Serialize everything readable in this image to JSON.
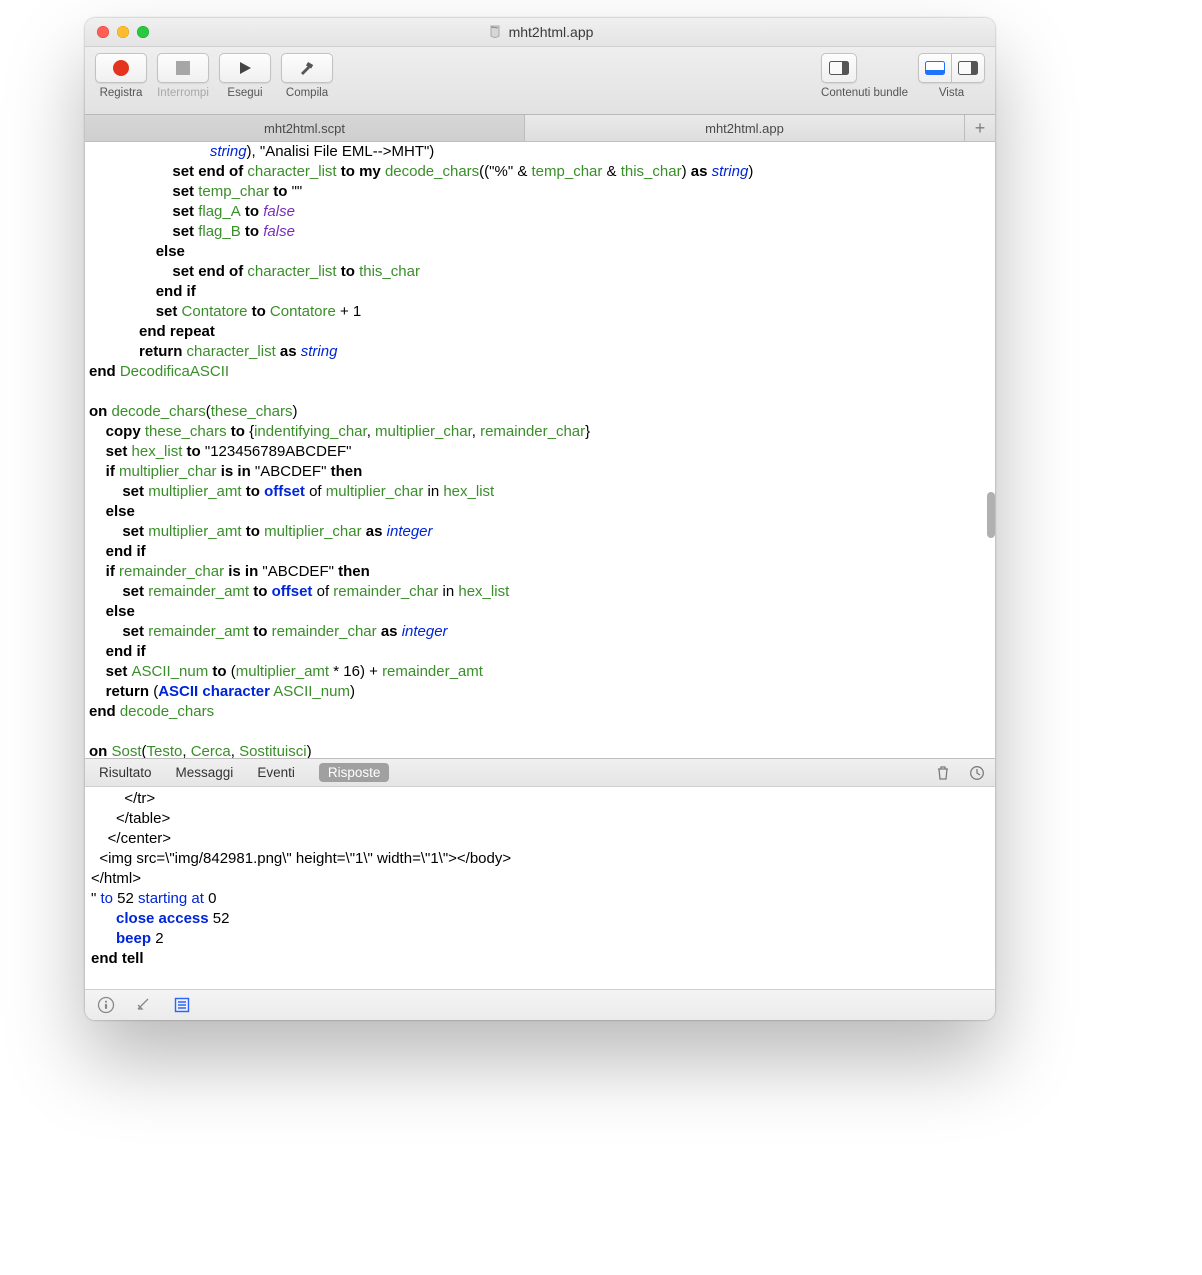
{
  "window": {
    "title": "mht2html.app"
  },
  "toolbar": {
    "record": "Registra",
    "stop": "Interrompi",
    "run": "Esegui",
    "compile": "Compila",
    "bundle": "Contenuti bundle",
    "view": "Vista"
  },
  "tabs": {
    "t1": "mht2html.scpt",
    "t2": "mht2html.app"
  },
  "code": {
    "l1a": "string",
    "l1b": "), \"Analisi File EML-->MHT\")",
    "l2a": "set ",
    "l2b": "end of",
    "l2c": " character_list",
    "l2d": " to my ",
    "l2e": "decode_chars",
    "l2f": "((\"%\" & ",
    "l2g": "temp_char",
    "l2h": " & ",
    "l2i": "this_char",
    "l2j": ") ",
    "l2k": "as ",
    "l2l": "string",
    "l2m": ")",
    "l3a": "set ",
    "l3b": "temp_char",
    "l3c": " to",
    "l3d": " \"\"",
    "l4a": "set ",
    "l4b": "flag_A",
    "l4c": " to ",
    "l4d": "false",
    "l5a": "set ",
    "l5b": "flag_B",
    "l5c": " to ",
    "l5d": "false",
    "l6": "else",
    "l7a": "set ",
    "l7b": "end of",
    "l7c": " character_list",
    "l7d": " to ",
    "l7e": "this_char",
    "l8": "end if",
    "l9a": "set ",
    "l9b": "Contatore",
    "l9c": " to ",
    "l9d": "Contatore",
    "l9e": " + 1",
    "l10": "end repeat",
    "l11a": "return ",
    "l11b": "character_list",
    "l11c": " as ",
    "l11d": "string",
    "l12a": "end",
    "l12b": " DecodificaASCII",
    "l13": "",
    "l14a": "on ",
    "l14b": "decode_chars",
    "l14c": "(",
    "l14d": "these_chars",
    "l14e": ")",
    "l15a": "copy ",
    "l15b": "these_chars",
    "l15c": " to ",
    "l15d": "{",
    "l15e": "indentifying_char",
    "l15f": ", ",
    "l15g": "multiplier_char",
    "l15h": ", ",
    "l15i": "remainder_char",
    "l15j": "}",
    "l16a": "set ",
    "l16b": "hex_list",
    "l16c": " to",
    "l16d": " \"123456789ABCDEF\"",
    "l17a": "if ",
    "l17b": "multiplier_char",
    "l17c": " is in",
    "l17d": " \"ABCDEF\" ",
    "l17e": "then",
    "l18a": "set ",
    "l18b": "multiplier_amt",
    "l18c": " to ",
    "l18d": "offset",
    "l18e": " of ",
    "l18f": "multiplier_char",
    "l18g": " in ",
    "l18h": "hex_list",
    "l19": "else",
    "l20a": "set ",
    "l20b": "multiplier_amt",
    "l20c": " to ",
    "l20d": "multiplier_char",
    "l20e": " as ",
    "l20f": "integer",
    "l21": "end if",
    "l22a": "if ",
    "l22b": "remainder_char",
    "l22c": " is in",
    "l22d": " \"ABCDEF\" ",
    "l22e": "then",
    "l23a": "set ",
    "l23b": "remainder_amt",
    "l23c": " to ",
    "l23d": "offset",
    "l23e": " of ",
    "l23f": "remainder_char",
    "l23g": " in ",
    "l23h": "hex_list",
    "l24": "else",
    "l25a": "set ",
    "l25b": "remainder_amt",
    "l25c": " to ",
    "l25d": "remainder_char",
    "l25e": " as ",
    "l25f": "integer",
    "l26": "end if",
    "l27a": "set ",
    "l27b": "ASCII_num",
    "l27c": " to ",
    "l27d": "(",
    "l27e": "multiplier_amt",
    "l27f": " * 16) + ",
    "l27g": "remainder_amt",
    "l28a": "return ",
    "l28b": "(",
    "l28c": "ASCII character",
    "l28d": " ASCII_num",
    "l28e": ")",
    "l29a": "end",
    "l29b": " decode_chars",
    "l30": "",
    "l31a": "on ",
    "l31b": "Sost",
    "l31c": "(",
    "l31d": "Testo",
    "l31e": ", ",
    "l31f": "Cerca",
    "l31g": ", ",
    "l31h": "Sostituisci",
    "l31i": ")"
  },
  "results": {
    "tabs": {
      "risultato": "Risultato",
      "messaggi": "Messaggi",
      "eventi": "Eventi",
      "risposte": "Risposte"
    },
    "r1": "        </tr>",
    "r2": "      </table>",
    "r3": "    </center>",
    "r4": "  <img src=\\\"img/842981.png\\\" height=\\\"1\\\" width=\\\"1\\\"></body>",
    "r5": "</html>",
    "r6a": "\" ",
    "r6b": "to",
    "r6c": " 52 ",
    "r6d": "starting at",
    "r6e": " 0",
    "r7a": "close access",
    "r7b": " 52",
    "r8a": "beep",
    "r8b": " 2",
    "r9": "end tell"
  }
}
